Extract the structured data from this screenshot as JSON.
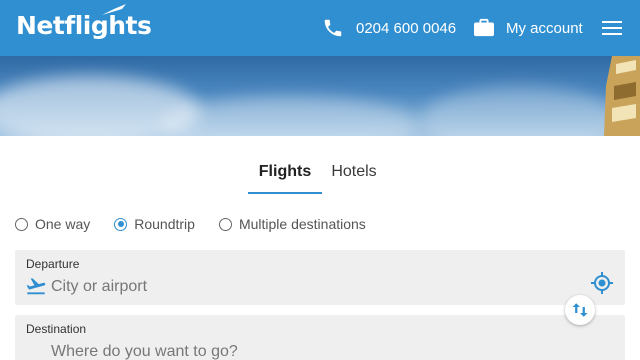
{
  "header": {
    "logo_text": "Netflights",
    "phone": "0204 600 0046",
    "account_label": "My account",
    "brand_color": "#2f8fd0"
  },
  "tabs": [
    {
      "label": "Flights",
      "active": true
    },
    {
      "label": "Hotels",
      "active": false
    }
  ],
  "trip_types": [
    {
      "label": "One way",
      "checked": false
    },
    {
      "label": "Roundtrip",
      "checked": true
    },
    {
      "label": "Multiple destinations",
      "checked": false
    }
  ],
  "departure": {
    "label": "Departure",
    "placeholder": "City or airport"
  },
  "destination": {
    "label": "Destination",
    "placeholder": "Where do you want to go?"
  },
  "icons": [
    "phone-icon",
    "briefcase-icon",
    "menu-icon",
    "takeoff-icon",
    "locate-icon",
    "swap-icon"
  ]
}
